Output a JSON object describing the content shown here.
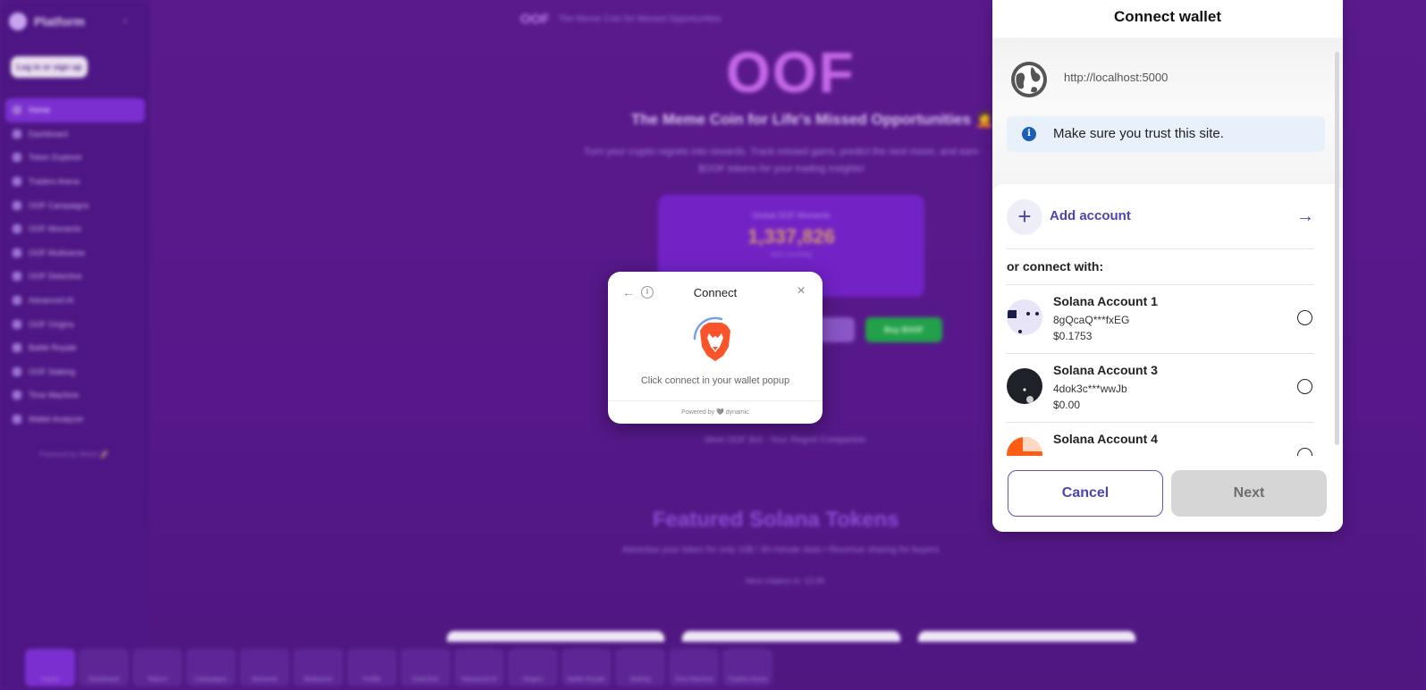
{
  "app": {
    "brand": "Platform",
    "login_label": "Log in or sign up",
    "nav": [
      "Home",
      "Dashboard",
      "Token Explorer",
      "Traders Arena",
      "OOF Campaigns",
      "OOF Moments",
      "OOF Multiverse",
      "OOF Detective",
      "Advanced AI",
      "OOF Origins",
      "Battle Royale",
      "OOF Staking",
      "Time Machine",
      "Wallet Analyzer"
    ],
    "powered": "Powered by Web3 🚀",
    "topbar_logo": "OOF",
    "topbar_text": "The Meme Coin for Missed Opportunities",
    "hero_title": "OOF",
    "hero_sub": "The Meme Coin for Life's Missed Opportunities 🤦",
    "hero_desc": "Turn your crypto regrets into rewards. Track missed gains, predict the next moon, and earn $OOF tokens for your trading insights!",
    "stat_label": "Global OOF Moments",
    "stat_value": "1,337,826",
    "stat_foot": "and counting",
    "buy_label": "Buy $OOF",
    "bot_line": "Meet OOF Bot - Your Regret Companion",
    "featured_title": "Featured Solana Tokens",
    "featured_sub": "Advertise your token for only 10$ / 30-minute slots • Revenue sharing for buyers",
    "next_rotation": "Next rotation in: 13:39",
    "bottom_nav": [
      "Home",
      "Dashboard",
      "Tokens",
      "Campaigns",
      "Moments",
      "Multiverse",
      "Profile",
      "Detective",
      "Advanced AI",
      "Origins",
      "Battle Royale",
      "Staking",
      "Time Machine",
      "Traders Arena"
    ]
  },
  "popup": {
    "title": "Connect",
    "message": "Click connect in your wallet popup",
    "footer": "Powered by 🩶 dynamic"
  },
  "wallet": {
    "title": "Connect wallet",
    "site_url": "http://localhost:5000",
    "trust_message": "Make sure you trust this site.",
    "add_account": "Add account",
    "or_connect": "or connect with:",
    "accounts": [
      {
        "name": "Solana Account 1",
        "address": "8gQcaQ***fxEG",
        "balance": "$0.1753"
      },
      {
        "name": "Solana Account 3",
        "address": "4dok3c***wwJb",
        "balance": "$0.00"
      },
      {
        "name": "Solana Account 4",
        "address": "",
        "balance": ""
      }
    ],
    "cancel_label": "Cancel",
    "next_label": "Next"
  }
}
